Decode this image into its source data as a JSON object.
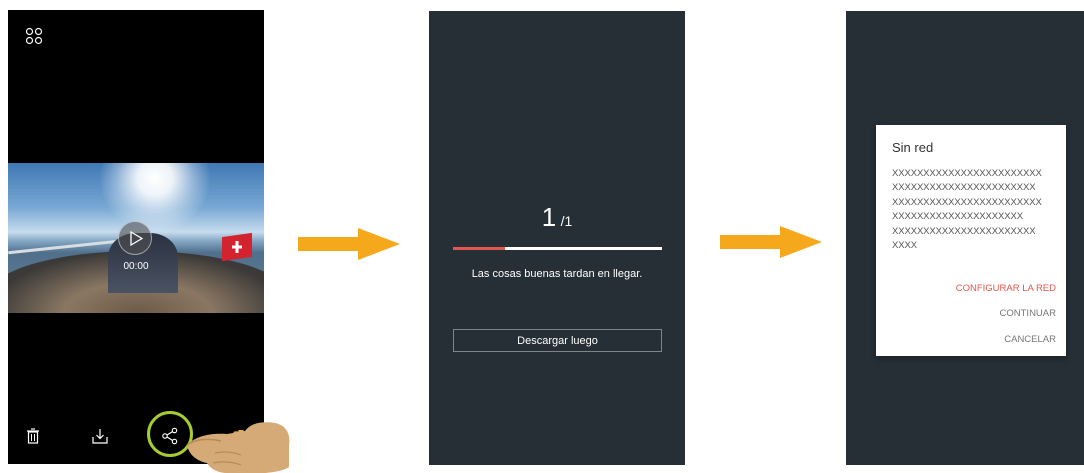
{
  "screen1": {
    "video_time": "00:00",
    "icons": [
      "grid-icon",
      "play-icon",
      "trash-icon",
      "download-icon",
      "share-icon",
      "camera-switch-icon",
      "hand-pointer-icon"
    ],
    "highlight_color": "#a6cd2f"
  },
  "screen2": {
    "counter_current": "1",
    "counter_total": "/1",
    "progress_fraction": 0.25,
    "slogan": "Las cosas buenas tardan en llegar.",
    "later_button": "Descargar luego",
    "accent_color": "#e0574f"
  },
  "screen3": {
    "dialog": {
      "title": "Sin red",
      "body_lines": [
        "XXXXXXXXXXXXXXXXXXXXXXXX",
        "XXXXXXXXXXXXXXXXXXXXXXX",
        "XXXXXXXXXXXXXXXXXXXXXXXX",
        "XXXXXXXXXXXXXXXXXXXXX",
        "XXXXXXXXXXXXXXXXXXXXXXX",
        "XXXX"
      ],
      "actions": {
        "configure": "CONFIGURAR LA RED",
        "continue": "CONTINUAR",
        "cancel": "CANCELAR"
      }
    }
  },
  "arrow_color": "#f6a81c",
  "background_color": "#262e36"
}
